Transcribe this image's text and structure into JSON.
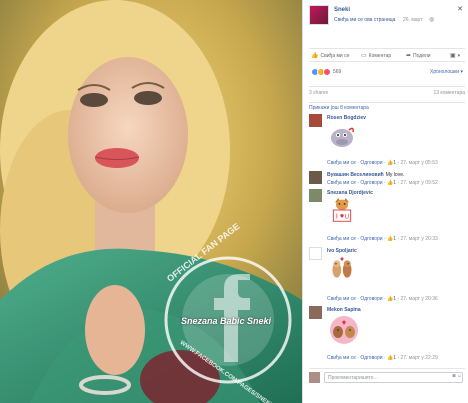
{
  "post": {
    "page_name": "Sneki",
    "like_page": "Свиђа ми се ова страница",
    "date": "26. март"
  },
  "watermark": {
    "top_text": "OFFICIAL FAN PAGE",
    "signature": "Snezana Babic Sneki",
    "bottom_text": "WWW.FACEBOOK.COM/PAGES/SNEKI"
  },
  "actions": {
    "like": "Свиђа ми се",
    "comment": "Коментар",
    "share": "Подели"
  },
  "reactions": {
    "count": "569",
    "order": "Хронолошки"
  },
  "stats": {
    "shares": "3 shares",
    "comments": "13 коментара"
  },
  "previous": "Прикажи још 8 коментара",
  "comments": [
    {
      "name": "Rosen Bogdziev",
      "text": "",
      "sticker": "hippo",
      "like": "Свиђа ми се",
      "reply": "Одговори",
      "likes": "1",
      "time": "27. март у 05:53"
    },
    {
      "name": "Вукашин Веселиновић",
      "text": "My love.",
      "sticker": "",
      "like": "Свиђа ми се",
      "reply": "Одговори",
      "likes": "1",
      "time": "27. март у 09:52"
    },
    {
      "name": "Snezana Djordjevic",
      "text": "",
      "sticker": "I love you dog",
      "like": "Свиђа ми се",
      "reply": "Одговори",
      "likes": "1",
      "time": "27. март у 20:33"
    },
    {
      "name": "Ivo Spoljaric",
      "text": "",
      "sticker": "dogs",
      "like": "Свиђа ми се",
      "reply": "Одговори",
      "likes": "1",
      "time": "27. март у 20:36"
    },
    {
      "name": "Mekon Sapina",
      "text": "",
      "sticker": "kiss",
      "like": "Свиђа ми се",
      "reply": "Одговори",
      "likes": "1",
      "time": "27. март у 22:29"
    }
  ],
  "composer": {
    "placeholder": "Прокоментаришите..."
  },
  "colors": {
    "link": "#365899",
    "accent": "#4267b2",
    "muted": "#90949c",
    "like_blue": "#5890ff"
  }
}
